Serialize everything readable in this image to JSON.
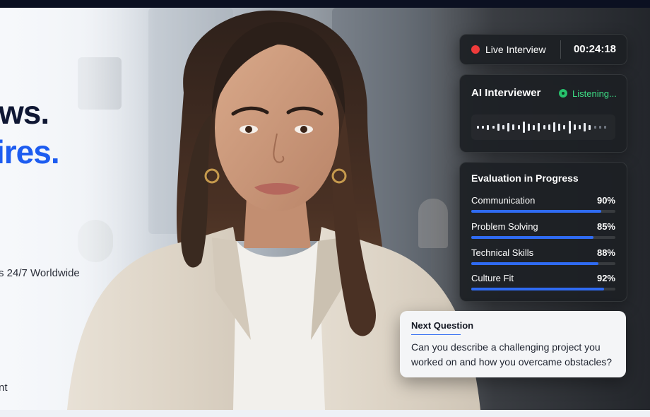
{
  "hero": {
    "headline_line1": "ws.",
    "headline_line2": "ires.",
    "subline_1": "s 24/7 Worldwide",
    "subline_2": "nt"
  },
  "live_status": {
    "label": "Live Interview",
    "timer": "00:24:18",
    "indicator_color": "#ef3b3b"
  },
  "ai_interviewer": {
    "title": "AI Interviewer",
    "status": "Listening...",
    "status_color": "#3ddc84"
  },
  "evaluation": {
    "title": "Evaluation in Progress",
    "accent_color": "#2f6bf2",
    "metrics": [
      {
        "name": "Communication",
        "percent_label": "90%",
        "value": 0.9
      },
      {
        "name": "Problem Solving",
        "percent_label": "85%",
        "value": 0.85
      },
      {
        "name": "Technical Skills",
        "percent_label": "88%",
        "value": 0.88
      },
      {
        "name": "Culture Fit",
        "percent_label": "92%",
        "value": 0.92
      }
    ]
  },
  "next_question": {
    "title": "Next Question",
    "text": "Can you describe a challenging project you worked on and how you overcame obstacles?"
  },
  "icons": {
    "live": "record-dot-icon",
    "listening": "mic-status-icon",
    "waveform": "audio-waveform-icon"
  }
}
